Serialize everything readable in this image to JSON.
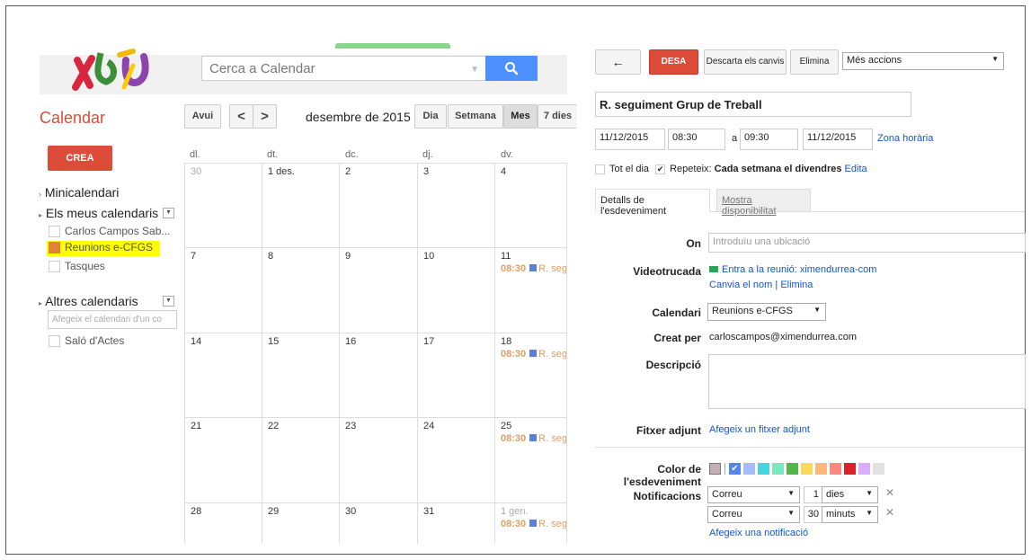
{
  "header": {
    "search_placeholder": "Cerca a Calendar",
    "app_title": "Calendar"
  },
  "toolbar": {
    "today": "Avui",
    "prev": "<",
    "next": ">",
    "date_range": "desembre de 2015",
    "views": [
      "Dia",
      "Setmana",
      "Mes",
      "7 dies"
    ]
  },
  "sidebar": {
    "create": "CREA",
    "minicalendar": "Minicalendari",
    "my_calendars": "Els meus calendaris",
    "my_items": [
      "Carlos Campos Sab...",
      "Reunions e-CFGS",
      "Tasques"
    ],
    "other_calendars": "Altres calendaris",
    "add_calendar_placeholder": "Afegeix el calendari d'un co",
    "other_items": [
      "Saló d'Actes"
    ]
  },
  "grid": {
    "weekdays": [
      "dl.",
      "dt.",
      "dc.",
      "dj.",
      "dv."
    ],
    "rows": [
      [
        "30",
        "1 des.",
        "2",
        "3",
        "4"
      ],
      [
        "7",
        "8",
        "9",
        "10",
        "11"
      ],
      [
        "14",
        "15",
        "16",
        "17",
        "18"
      ],
      [
        "21",
        "22",
        "23",
        "24",
        "25"
      ],
      [
        "28",
        "29",
        "30",
        "31",
        "1 gen."
      ]
    ],
    "event_time": "08:30",
    "event_title": "R. seg"
  },
  "editor": {
    "back": "←",
    "save": "DESA",
    "discard": "Descarta els canvis",
    "delete": "Elimina",
    "more_actions": "Més accions",
    "title": "R. seguiment Grup de Treball",
    "start_date": "11/12/2015",
    "start_time": "08:30",
    "to": "a",
    "end_time": "09:30",
    "end_date": "11/12/2015",
    "timezone": "Zona horària",
    "all_day": "Tot el dia",
    "repeat": "Repeteix:",
    "repeat_text": "Cada setmana el divendres",
    "edit": "Edita",
    "tabs": [
      "Detalls de l'esdeveniment",
      "Mostra disponibilitat"
    ],
    "where_label": "On",
    "where_placeholder": "Introduïu una ubicació",
    "video_label": "Videotrucada",
    "video_link": "Entra a la reunió: ximendurrea-com",
    "rename": "Canvia el nom",
    "sep": "|",
    "remove": "Elimina",
    "calendar_label": "Calendari",
    "calendar_value": "Reunions e-CFGS",
    "created_label": "Creat per",
    "created_value": "carloscampos@ximendurrea.com",
    "desc_label": "Descripció",
    "attach_label": "Fitxer adjunt",
    "attach_link": "Afegeix un fitxer adjunt",
    "color_label": "Color de l'esdeveniment",
    "notif_label": "Notificacions",
    "notifs": [
      {
        "type": "Correu",
        "amount": "1",
        "unit": "dies"
      },
      {
        "type": "Correu",
        "amount": "30",
        "unit": "minuts"
      }
    ],
    "add_notif": "Afegeix una notificació",
    "colors": [
      "#a4bdfc",
      "#7ae7bf",
      "#dbadff",
      "#ff887c",
      "#fbd75b",
      "#ffb878",
      "#46d6db",
      "#e1e1e1",
      "#5484ed",
      "#51b749",
      "#dc2127"
    ]
  }
}
